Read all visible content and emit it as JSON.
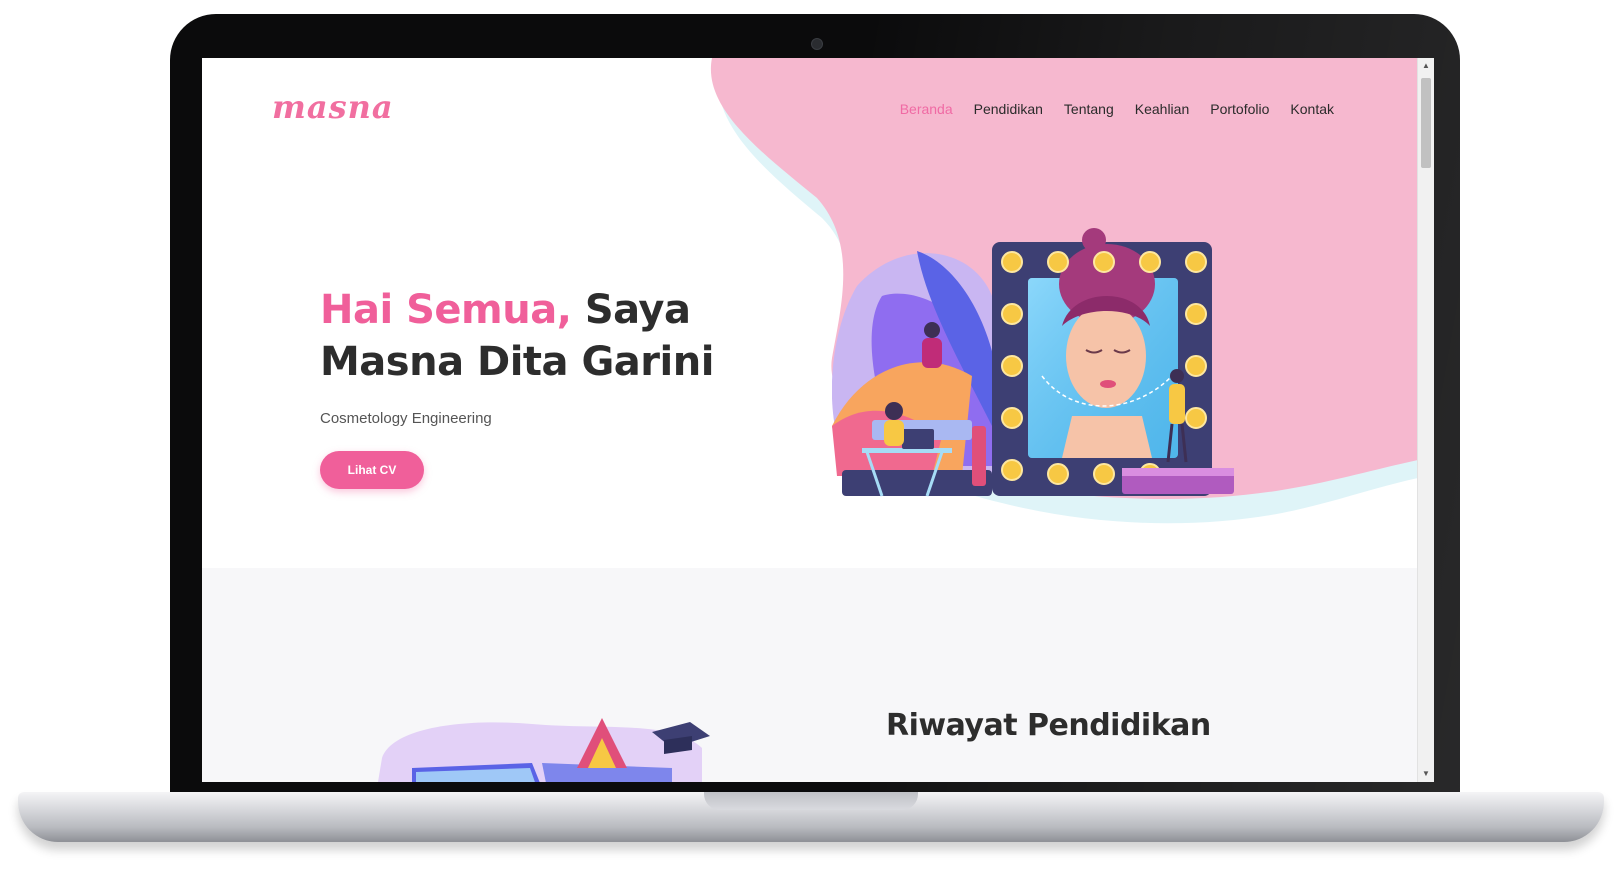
{
  "site": {
    "logo": "masna",
    "nav": [
      {
        "label": "Beranda",
        "active": true
      },
      {
        "label": "Pendidikan",
        "active": false
      },
      {
        "label": "Tentang",
        "active": false
      },
      {
        "label": "Keahlian",
        "active": false
      },
      {
        "label": "Portofolio",
        "active": false
      },
      {
        "label": "Kontak",
        "active": false
      }
    ]
  },
  "hero": {
    "greeting": "Hai Semua,",
    "intro_rest": " Saya",
    "name": "Masna Dita Garini",
    "subtitle": "Cosmetology Engineering",
    "cta_label": "Lihat CV"
  },
  "education": {
    "title": "Riwayat Pendidikan"
  },
  "icons": {
    "scroll_up": "arrow-up-icon",
    "scroll_down": "arrow-down-icon"
  },
  "colors": {
    "accent": "#f05f9a",
    "hero_blob": "#f6b8cf",
    "blob_outline": "#dff4f8"
  }
}
